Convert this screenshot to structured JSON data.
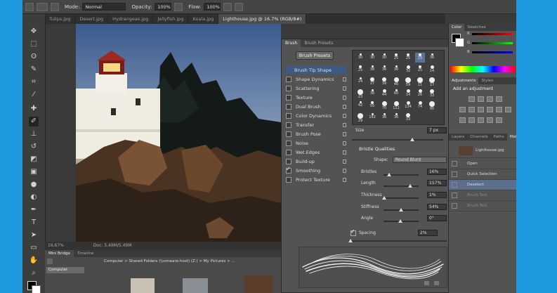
{
  "options_bar": {
    "mode_label": "Mode:",
    "mode_value": "Normal",
    "opacity_label": "Opacity:",
    "opacity_value": "100%",
    "flow_label": "Flow:",
    "flow_value": "100%"
  },
  "doc_tabs": [
    {
      "label": "Tulips.jpg"
    },
    {
      "label": "Desert.jpg"
    },
    {
      "label": "Hydrangeas.jpg"
    },
    {
      "label": "Jellyfish.jpg"
    },
    {
      "label": "Koala.jpg"
    },
    {
      "label": "Lighthouse.jpg @ 16.7% (RGB/8#)"
    }
  ],
  "status_bar": {
    "zoom": "16.67%",
    "doc": "Doc: 5.49M/5.49M"
  },
  "bridge": {
    "tabs": [
      "Mini Bridge",
      "Timeline"
    ],
    "path": "Computer > Shared Folders (\\\\vmware-host) (Z:) > My Pictures > ...",
    "dropdown": "Computer"
  },
  "brush_panel": {
    "tabs": [
      "Brush",
      "Brush Presets"
    ],
    "presets_button": "Brush Presets",
    "options": [
      {
        "label": "Brush Tip Shape",
        "checked": false,
        "selected": true
      },
      {
        "label": "Shape Dynamics",
        "checked": false
      },
      {
        "label": "Scattering",
        "checked": false
      },
      {
        "label": "Texture",
        "checked": false
      },
      {
        "label": "Dual Brush",
        "checked": false
      },
      {
        "label": "Color Dynamics",
        "checked": false
      },
      {
        "label": "Transfer",
        "checked": false
      },
      {
        "label": "Brush Pose",
        "checked": false
      },
      {
        "label": "Noise",
        "checked": false
      },
      {
        "label": "Wet Edges",
        "checked": false
      },
      {
        "label": "Build-up",
        "checked": false
      },
      {
        "label": "Smoothing",
        "checked": true
      },
      {
        "label": "Protect Texture",
        "checked": false
      }
    ],
    "tip_sizes": [
      "30",
      "30",
      "30",
      "25",
      "25",
      "25",
      "36",
      "25",
      "36",
      "36",
      "36",
      "32",
      "25",
      "14",
      "24",
      "27",
      "39",
      "46",
      "59",
      "11",
      "17",
      "23",
      "36",
      "44",
      "60",
      "14",
      "26",
      "33",
      "42",
      "55",
      "70",
      "112",
      "134",
      "74",
      "95",
      "29",
      "192",
      "36",
      "36",
      "33"
    ],
    "size_label": "Size",
    "size_value": "7 px",
    "bristle_title": "Bristle Qualities",
    "shape_label": "Shape:",
    "shape_value": "Round Blunt",
    "bristles_label": "Bristles",
    "bristles_value": "16%",
    "length_label": "Length",
    "length_value": "157%",
    "thickness_label": "Thickness",
    "thickness_value": "1%",
    "stiffness_label": "Stiffness",
    "stiffness_value": "54%",
    "angle_label": "Angle",
    "angle_value": "0°",
    "spacing_label": "Spacing",
    "spacing_value": "2%"
  },
  "color_panel": {
    "tabs": [
      "Color",
      "Swatches"
    ],
    "channels": [
      "R",
      "G",
      "B"
    ]
  },
  "adjustments_panel": {
    "tabs": [
      "Adjustments",
      "Styles"
    ],
    "title": "Add an adjustment"
  },
  "history_panel": {
    "tabs": [
      "Layers",
      "Channels",
      "Paths",
      "History"
    ],
    "snapshot": "Lighthouse.jpg",
    "states": [
      "Open",
      "Quick Selection",
      "Deselect",
      "Brush Tool",
      "Brush Tool"
    ]
  }
}
